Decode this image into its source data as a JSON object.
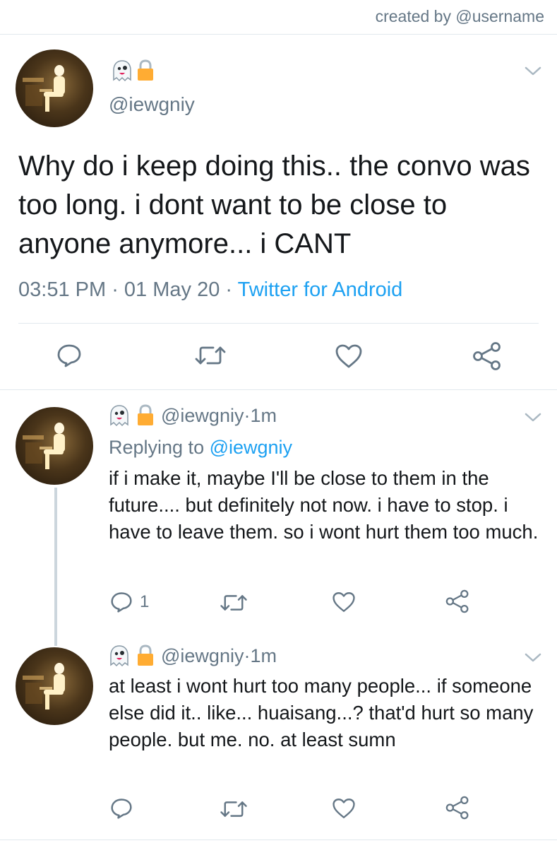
{
  "credit": "created by @username",
  "main_tweet": {
    "handle": "@iewgniy",
    "text": "Why do i keep doing this.. the convo was too long. i dont want to be close to anyone anymore... i CANT",
    "time": "03:51 PM",
    "sep1": " · ",
    "date": "01 May 20",
    "sep2": " · ",
    "source": "Twitter for Android",
    "icons": [
      "ghost-emoji",
      "lock-emoji"
    ]
  },
  "replies": [
    {
      "handle": "@iewgniy",
      "time_sep": " · ",
      "time": "1m",
      "replying_prefix": "Replying to ",
      "replying_to": "@iewgniy",
      "text": "if i make it, maybe I'll be close to them in the future.... but definitely not now. i have to stop. i have to leave them. so i wont hurt them too much.",
      "reply_count": "1"
    },
    {
      "handle": "@iewgniy",
      "time_sep": " · ",
      "time": "1m",
      "text": "at least i wont hurt too many people... if someone else did it.. like... huaisang...? that'd hurt so many people. but me. no. at least sumn",
      "reply_count": ""
    }
  ],
  "colors": {
    "text": "#14171a",
    "secondary": "#657786",
    "link": "#1da1f2",
    "divider": "#e1e8ed",
    "thread_line": "#ccd6dd"
  }
}
